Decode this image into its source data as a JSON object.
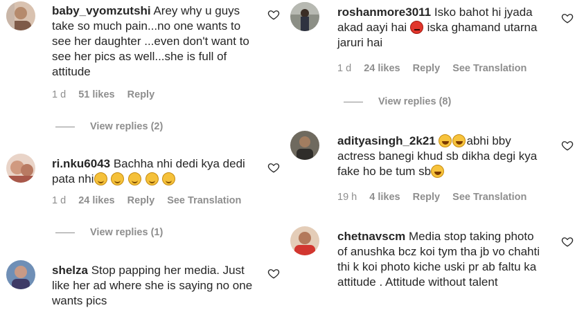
{
  "left_column": {
    "c1": {
      "username": "baby_vyomzutshi",
      "text": "Arey why u guys take so much pain...no one wants to see her daughter ...even don't want to see her pics as well...she is full of attitude",
      "time": "1 d",
      "likes": "51 likes",
      "reply": "Reply",
      "view_replies": "View replies (2)"
    },
    "c2": {
      "username": "ri.nku6043",
      "text": "Bachha nhi dedi kya dedi pata nhi",
      "emoji_count": 5,
      "time": "1 d",
      "likes": "24 likes",
      "reply": "Reply",
      "translate": "See Translation",
      "view_replies": "View replies (1)"
    },
    "c3": {
      "username": "shelza",
      "text": "Stop papping her media. Just like her ad where she is saying no one wants pics"
    }
  },
  "right_column": {
    "c1": {
      "username": "roshanmore3011",
      "text_a": "Isko bahot hi jyada akad aayi hai",
      "text_b": "iska ghamand utarna jaruri hai",
      "time": "1 d",
      "likes": "24 likes",
      "reply": "Reply",
      "translate": "See Translation",
      "view_replies": "View replies (8)"
    },
    "c2": {
      "username": "adityasingh_2k21",
      "text": "abhi bby actress banegi khud sb dikha degi kya fake ho be tum sb",
      "time": "19 h",
      "likes": "4 likes",
      "reply": "Reply",
      "translate": "See Translation"
    },
    "c3": {
      "username": "chetnavscm",
      "text": "Media stop taking photo of anushka bcz koi tym tha jb vo chahti thi k koi photo kiche uski pr ab faltu ka attitude . Attitude without talent"
    }
  },
  "icons": {
    "like": "heart-outline-icon"
  },
  "colors": {
    "text": "#262626",
    "meta": "#8e8e8e"
  }
}
